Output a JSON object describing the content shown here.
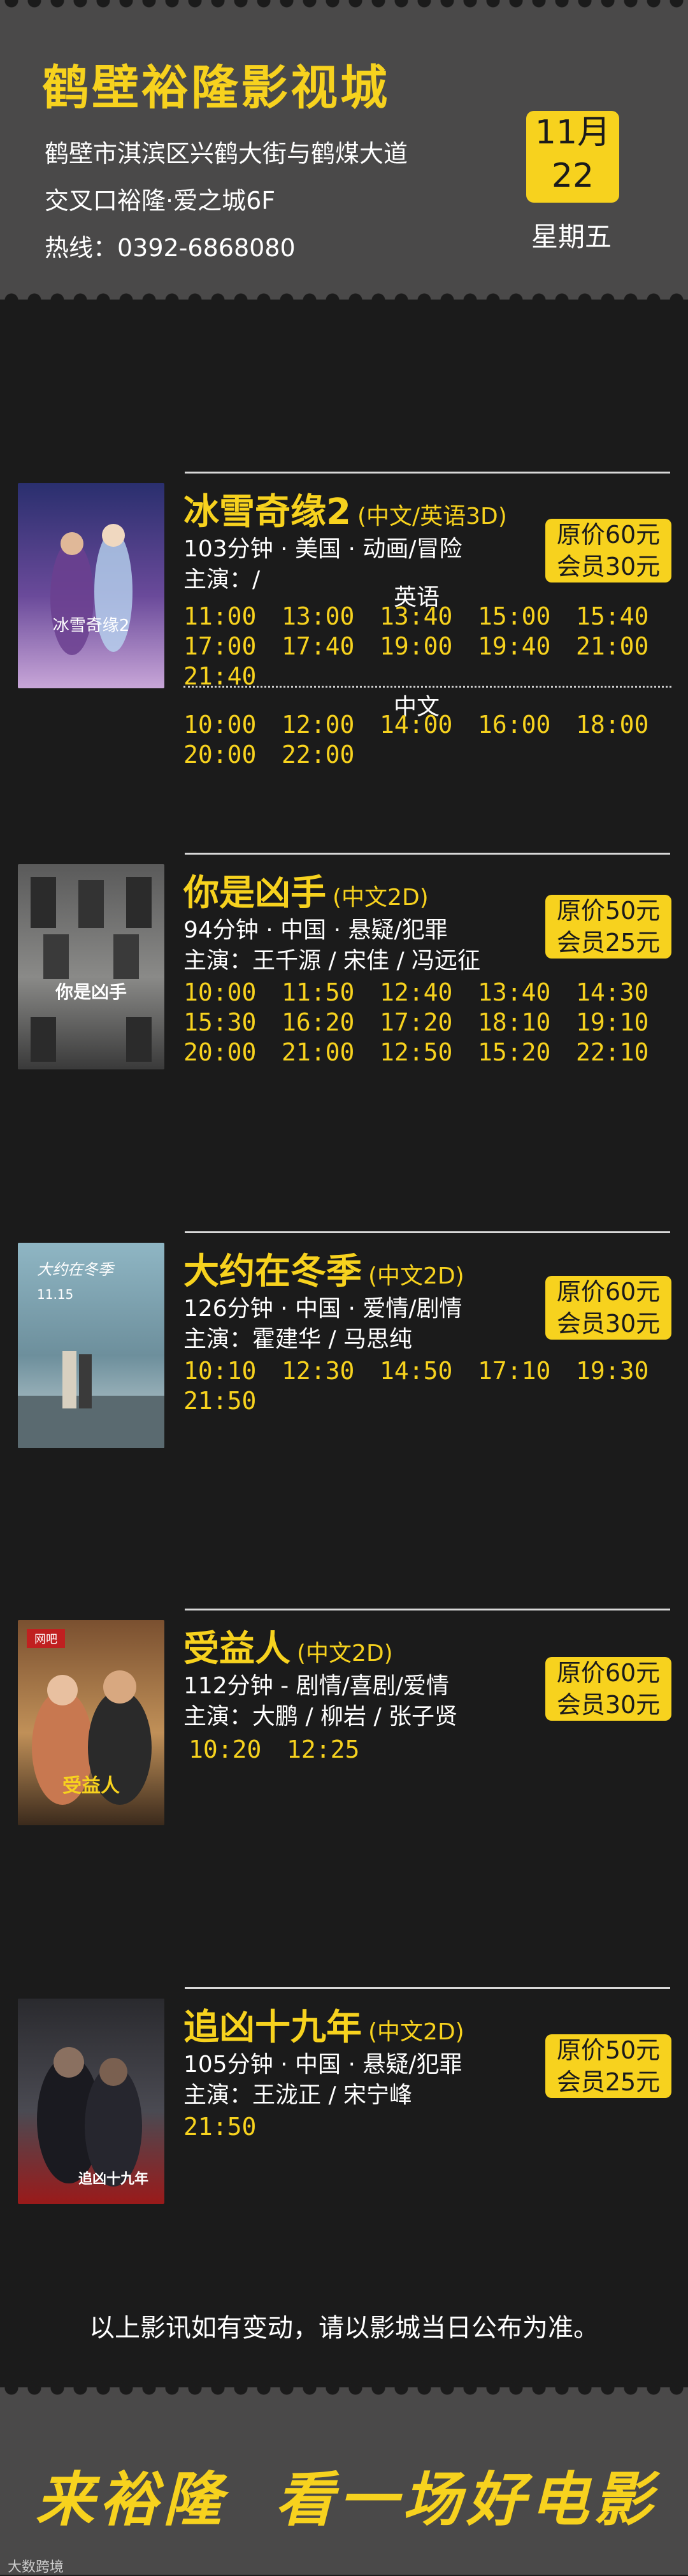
{
  "header": {
    "cinema_name": "鹤壁裕隆影视城",
    "address_line1": "鹤壁市淇滨区兴鹤大街与鹤煤大道",
    "address_line2": "交叉口裕隆·爱之城6F",
    "hotline": "热线：0392-6868080",
    "date_month": "11月",
    "date_day": "22",
    "weekday": "星期五"
  },
  "movies": [
    {
      "title": "冰雪奇缘2",
      "format": "(中文/英语3D)",
      "info": "103分钟 · 美国 · 动画/冒险",
      "cast": "主演：/",
      "price_original": "原价60元",
      "price_member": "会员30元",
      "lang1": "英语",
      "times1": [
        "11:00",
        "13:00",
        "13:40",
        "15:00",
        "15:40",
        "17:00",
        "17:40",
        "19:00",
        "19:40",
        "21:00",
        "21:40"
      ],
      "lang2": "中文",
      "times2": [
        "10:00",
        "12:00",
        "14:00",
        "16:00",
        "18:00",
        "20:00",
        "22:00"
      ]
    },
    {
      "title": "你是凶手",
      "format": "(中文2D)",
      "info": "94分钟 · 中国 · 悬疑/犯罪",
      "cast": "主演：王千源 / 宋佳 / 冯远征",
      "price_original": "原价50元",
      "price_member": "会员25元",
      "times": [
        "10:00",
        "11:50",
        "12:40",
        "13:40",
        "14:30",
        "15:30",
        "16:20",
        "17:20",
        "18:10",
        "19:10",
        "20:00",
        "21:00",
        "12:50",
        "15:20",
        "22:10"
      ]
    },
    {
      "title": "大约在冬季",
      "format": "(中文2D)",
      "info": "126分钟 · 中国 · 爱情/剧情",
      "cast": "主演：霍建华 / 马思纯",
      "price_original": "原价60元",
      "price_member": "会员30元",
      "times": [
        "10:10",
        "12:30",
        "14:50",
        "17:10",
        "19:30",
        "21:50"
      ]
    },
    {
      "title": "受益人",
      "format": "(中文2D)",
      "info": "112分钟 - 剧情/喜剧/爱情",
      "cast": "主演：大鹏 / 柳岩 / 张子贤",
      "price_original": "原价60元",
      "price_member": "会员30元",
      "times": [
        "10:20",
        "12:25"
      ]
    },
    {
      "title": "追凶十九年",
      "format": "(中文2D)",
      "info": "105分钟 · 中国 · 悬疑/犯罪",
      "cast": "主演：王泷正 / 宋宁峰",
      "price_original": "原价50元",
      "price_member": "会员25元",
      "times": [
        "21:50"
      ]
    }
  ],
  "posters": [
    {
      "text": "冰雪奇缘2",
      "colors": [
        "#2a2f6e",
        "#6a4a9a",
        "#c8a6d8"
      ]
    },
    {
      "text": "你是凶手",
      "colors": [
        "#5a5a5a",
        "#8a8a88",
        "#3a3a3a"
      ]
    },
    {
      "text": "大约在冬季",
      "text2": "11.15",
      "colors": [
        "#8fb6c4",
        "#6d8f9c",
        "#c9d6d9"
      ]
    },
    {
      "text": "受益人",
      "text2": "网吧",
      "colors": [
        "#7a5030",
        "#c09058",
        "#3b2a1c"
      ]
    },
    {
      "text": "追凶十九年",
      "colors": [
        "#2a2a2e",
        "#4a4a52",
        "#9a1a1a"
      ]
    }
  ],
  "notice": "以上影讯如有变动，请以影城当日公布为准。",
  "footer": {
    "slogan_left": "来裕隆",
    "slogan_right": "看一场好电影",
    "watermark": "大数跨境"
  },
  "colors": {
    "accent": "#f7d21e",
    "background": "#1b1b1b",
    "panel": "#4a4949"
  }
}
